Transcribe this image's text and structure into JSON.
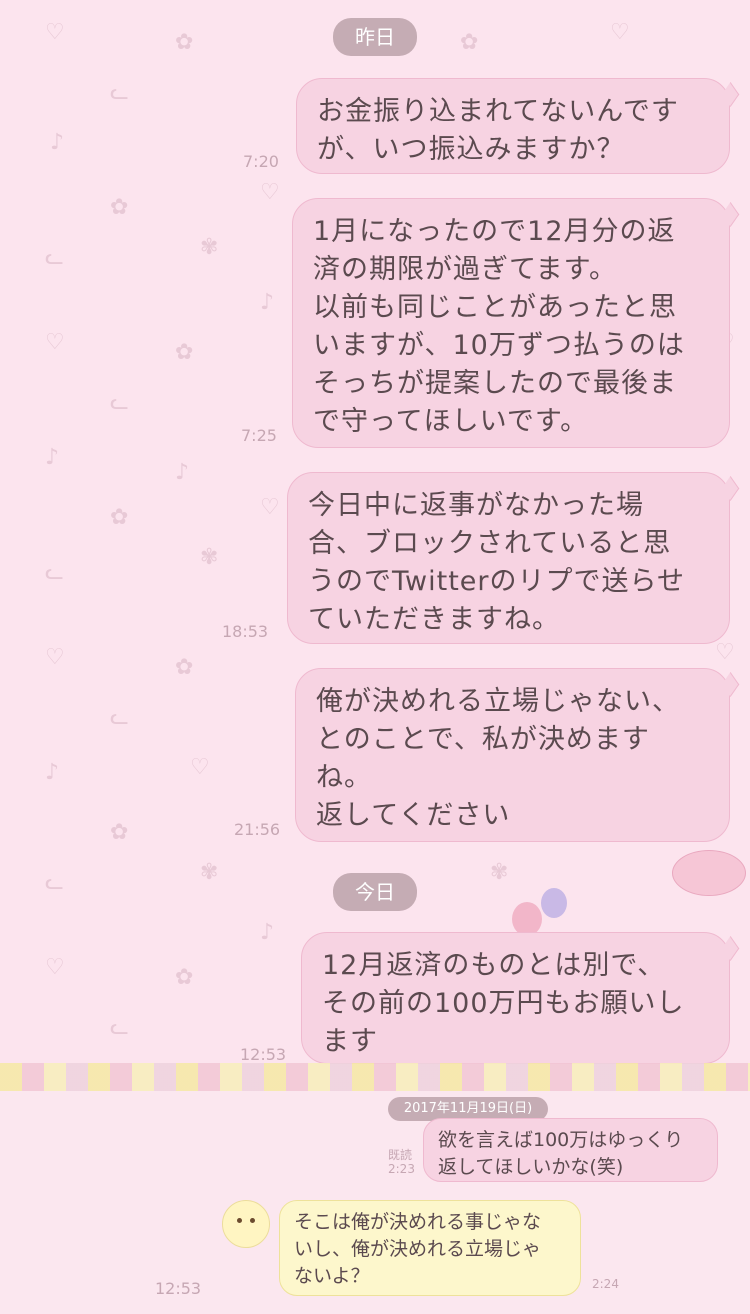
{
  "dates": {
    "yesterday": "昨日",
    "today": "今日",
    "screenshot_date": "2017年11月19日(日)"
  },
  "messages": [
    {
      "text": "お金振り込まれてないんです\nが、いつ振込みますか？",
      "time": "7:20"
    },
    {
      "text": "1月になったので12月分の返\n済の期限が過ぎてます。\n以前も同じことがあったと思\nいますが、10万ずつ払うのは\nそっちが提案したので最後ま\nで守ってほしいです。",
      "time": "7:25"
    },
    {
      "text": "今日中に返事がなかった場\n合、ブロックされていると思\nうのでTwitterのリプで送らせ\nていただきますね。",
      "time": "18:53"
    },
    {
      "text": "俺が決めれる立場じゃない、\nとのことで、私が決めます\nね。\n返してください",
      "time": "21:56"
    },
    {
      "text": "12月返済のものとは別で、\nその前の100万円もお願いし\nます",
      "time": "12:53"
    }
  ],
  "screenshot": {
    "sent": {
      "text": "欲を言えば100万はゆっくり\n返してほしいかな(笑)",
      "read": "既読",
      "time": "2:23"
    },
    "received": {
      "text": "そこは俺が決めれる事じゃな\nいし、俺が決めれる立場じゃ\nないよ？",
      "time": "2:24"
    }
  },
  "footer_time": "12:53",
  "colors": {
    "bubble": "#f7d3e2",
    "bubble_border": "#efb9cf",
    "text": "#5b4a4f",
    "background": "#fce4ee",
    "date_pill": "#c5acb4"
  },
  "icons": [
    "heart-icon",
    "flower-icon",
    "bunny-icon",
    "music-note-icon",
    "avatar-pompompurin-icon"
  ]
}
